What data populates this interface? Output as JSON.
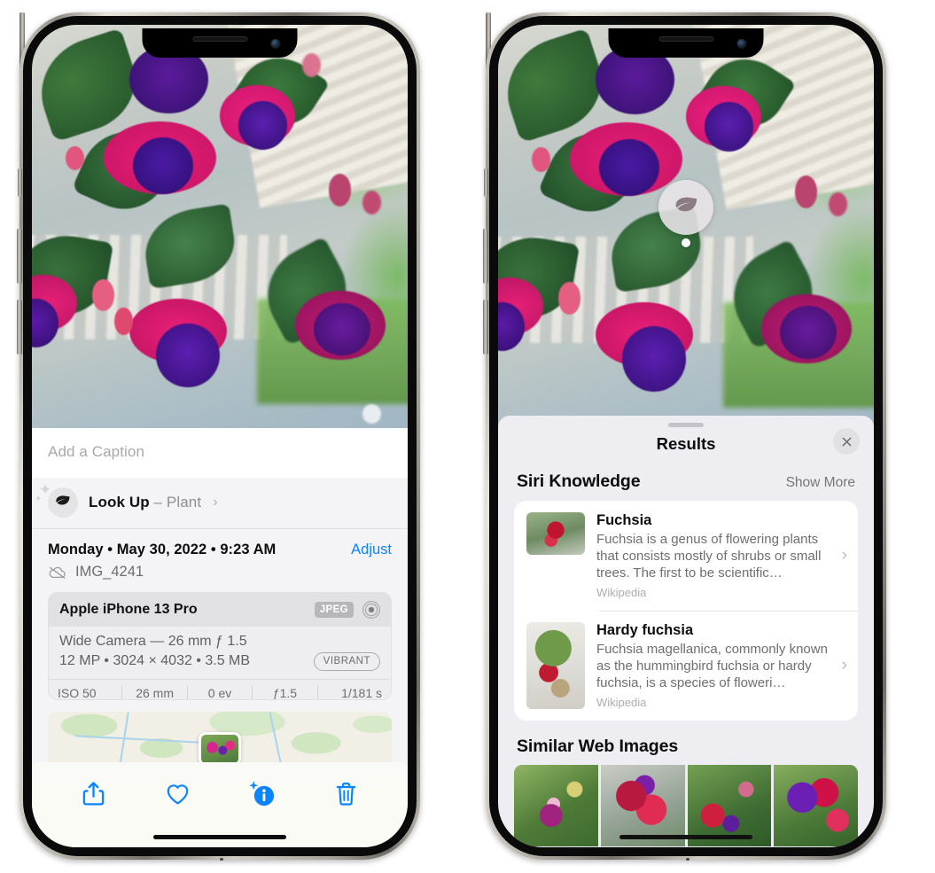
{
  "left_phone": {
    "caption_placeholder": "Add a Caption",
    "lookup": {
      "label": "Look Up",
      "dash": " – ",
      "subject": "Plant",
      "chevron": "›",
      "icon": "leaf-icon"
    },
    "date": "Monday • May 30, 2022 • 9:23 AM",
    "adjust_label": "Adjust",
    "file_name": "IMG_4241",
    "cloud_icon": "icloud-slash-icon",
    "exif": {
      "model": "Apple iPhone 13 Pro",
      "format_badge": "JPEG",
      "aperture_icon": "aperture-icon",
      "lens_line": "Wide Camera — 26 mm ƒ 1.5",
      "specs_line": "12 MP • 3024 × 4032 • 3.5 MB",
      "vibrant_badge": "VIBRANT",
      "stats": [
        "ISO 50",
        "26 mm",
        "0 ev",
        "ƒ1.5",
        "1/181 s"
      ]
    },
    "toolbar": [
      {
        "name": "share-button",
        "icon": "share-icon"
      },
      {
        "name": "favorite-button",
        "icon": "heart-icon"
      },
      {
        "name": "info-button",
        "icon": "info-sparkle-icon"
      },
      {
        "name": "delete-button",
        "icon": "trash-icon"
      }
    ],
    "accent_color": "#0a84ff"
  },
  "right_phone": {
    "visual_lookup_badge": "leaf-icon",
    "sheet": {
      "title": "Results",
      "close_label": "close-icon",
      "sections": [
        {
          "title": "Siri Knowledge",
          "action": "Show More",
          "items": [
            {
              "title": "Fuchsia",
              "description": "Fuchsia is a genus of flowering plants that consists mostly of shrubs or small trees. The first to be scientific…",
              "source": "Wikipedia",
              "chevron": "›"
            },
            {
              "title": "Hardy fuchsia",
              "description": "Fuchsia magellanica, commonly known as the hummingbird fuchsia or hardy fuchsia, is a species of floweri…",
              "source": "Wikipedia",
              "chevron": "›"
            }
          ]
        },
        {
          "title": "Similar Web Images",
          "thumbnails": [
            "web-image-1",
            "web-image-2",
            "web-image-3",
            "web-image-4"
          ]
        }
      ]
    }
  }
}
